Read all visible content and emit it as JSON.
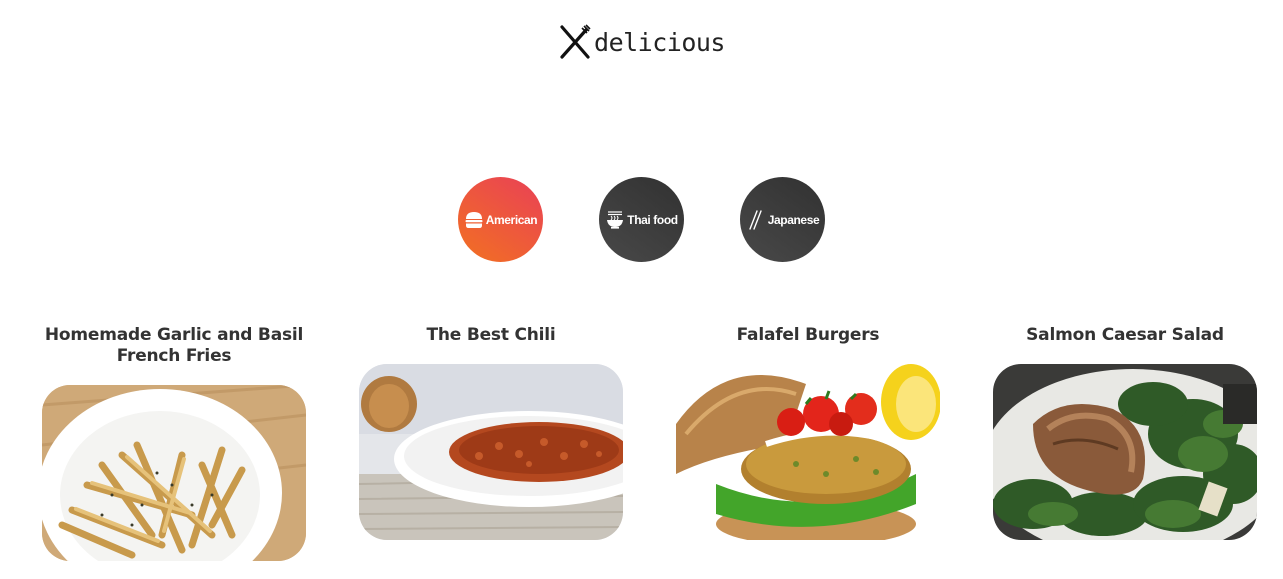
{
  "logo": {
    "text": "delicious",
    "icon": "cutlery-icon"
  },
  "categories": [
    {
      "label": "American",
      "icon": "burger-icon",
      "active": true
    },
    {
      "label": "Thai food",
      "icon": "noodle-bowl-icon",
      "active": false
    },
    {
      "label": "Japanese",
      "icon": "chopsticks-icon",
      "active": false
    }
  ],
  "recipes": [
    {
      "title": "Homemade Garlic and Basil French Fries",
      "image": "french-fries-photo"
    },
    {
      "title": "The Best Chili",
      "image": "chili-photo"
    },
    {
      "title": "Falafel Burgers",
      "image": "falafel-burger-photo"
    },
    {
      "title": "Salmon Caesar Salad",
      "image": "salmon-caesar-salad-photo"
    }
  ],
  "colors": {
    "active_gradient_start": "#f27121",
    "active_gradient_end": "#e94057",
    "inactive_gradient_start": "#494949",
    "inactive_gradient_end": "#313131"
  }
}
